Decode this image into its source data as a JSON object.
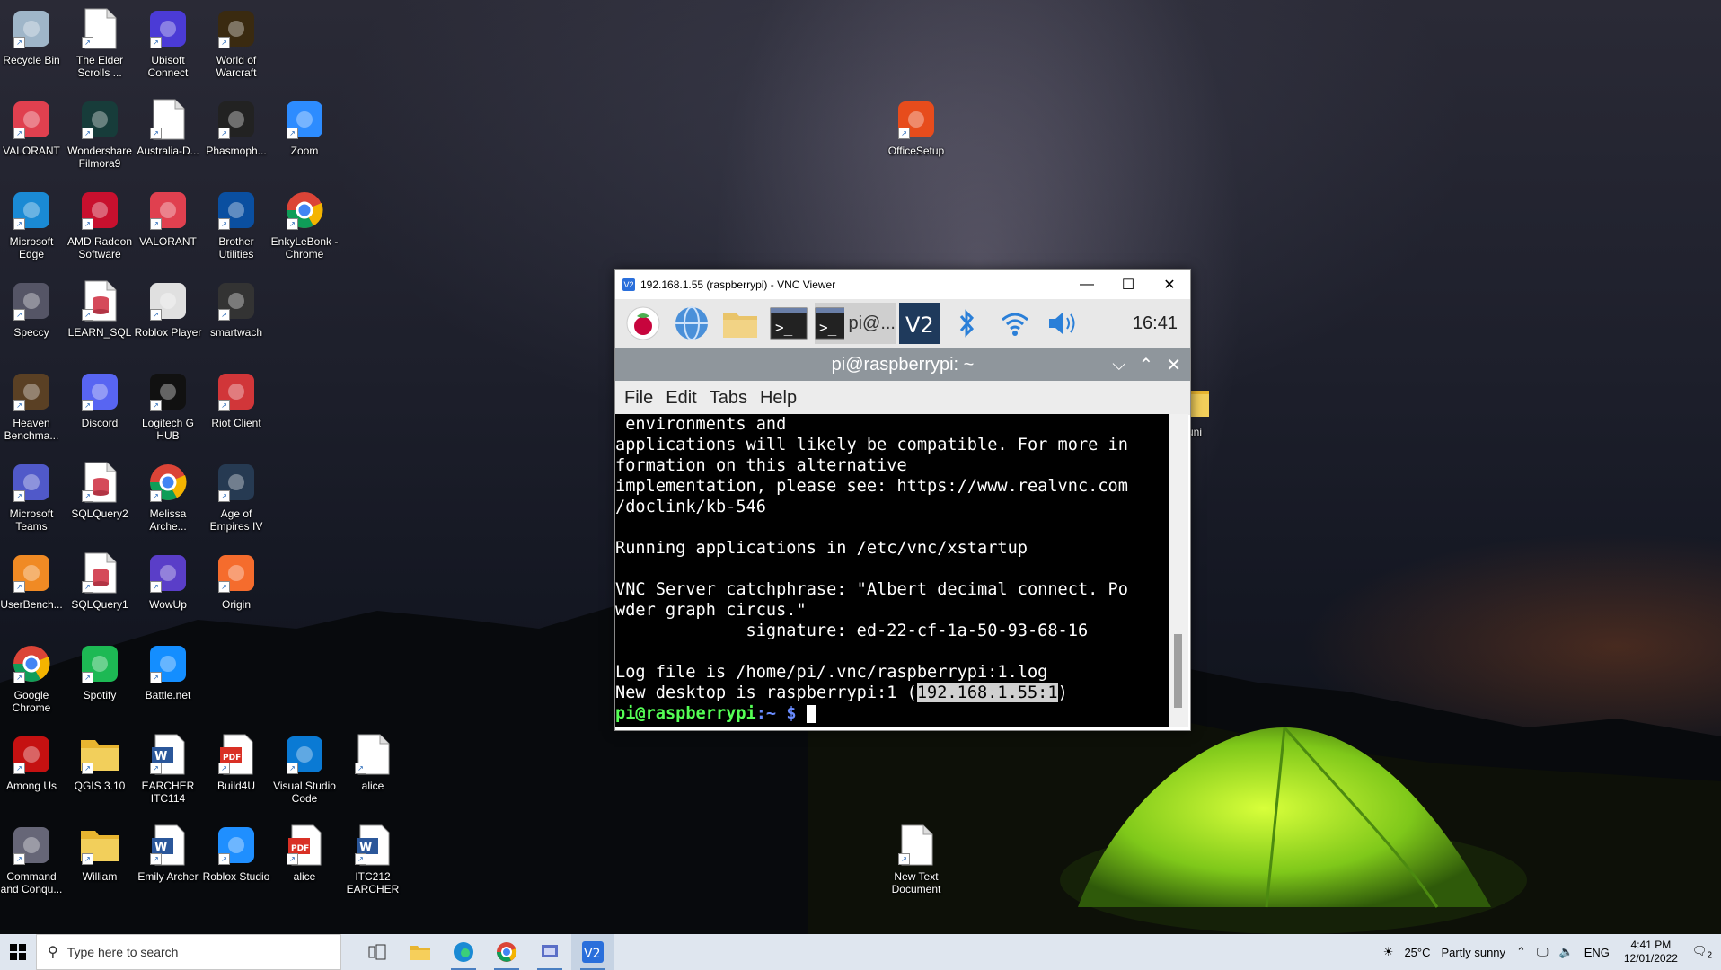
{
  "desktop": {
    "icons": [
      {
        "label": "Recycle Bin",
        "icon": "recycle-bin-icon"
      },
      {
        "label": "The Elder Scrolls ...",
        "icon": "file-icon"
      },
      {
        "label": "Ubisoft Connect",
        "icon": "ubisoft-icon"
      },
      {
        "label": "World of Warcraft",
        "icon": "warcraft-icon"
      },
      {
        "label": "VALORANT",
        "icon": "valorant-icon"
      },
      {
        "label": "Wondershare Filmora9",
        "icon": "filmora-icon"
      },
      {
        "label": "Australia-D...",
        "icon": "file-icon"
      },
      {
        "label": "Phasmoph...",
        "icon": "phasmophobia-icon"
      },
      {
        "label": "Zoom",
        "icon": "zoom-icon"
      },
      {
        "label": "Microsoft Edge",
        "icon": "edge-icon"
      },
      {
        "label": "AMD Radeon Software",
        "icon": "amd-icon"
      },
      {
        "label": "VALORANT",
        "icon": "valorant-icon"
      },
      {
        "label": "Brother Utilities",
        "icon": "brother-icon"
      },
      {
        "label": "EnkyLeBonk - Chrome",
        "icon": "chrome-icon"
      },
      {
        "label": "Speccy",
        "icon": "speccy-icon"
      },
      {
        "label": "LEARN_SQL",
        "icon": "sql-icon"
      },
      {
        "label": "Roblox Player",
        "icon": "roblox-icon"
      },
      {
        "label": "smartwach",
        "icon": "smartwatch-icon"
      },
      {
        "label": "Heaven Benchma...",
        "icon": "heaven-icon"
      },
      {
        "label": "Discord",
        "icon": "discord-icon"
      },
      {
        "label": "Logitech G HUB",
        "icon": "logitech-icon"
      },
      {
        "label": "Riot Client",
        "icon": "riot-icon"
      },
      {
        "label": "Microsoft Teams",
        "icon": "teams-icon"
      },
      {
        "label": "SQLQuery2",
        "icon": "sql-icon"
      },
      {
        "label": "Melissa Arche...",
        "icon": "chrome-icon"
      },
      {
        "label": "Age of Empires IV",
        "icon": "aoe-icon"
      },
      {
        "label": "UserBench...",
        "icon": "userbenchmark-icon"
      },
      {
        "label": "SQLQuery1",
        "icon": "sql-icon"
      },
      {
        "label": "WowUp",
        "icon": "wowup-icon"
      },
      {
        "label": "Origin",
        "icon": "origin-icon"
      },
      {
        "label": "Google Chrome",
        "icon": "chrome-icon"
      },
      {
        "label": "Spotify",
        "icon": "spotify-icon"
      },
      {
        "label": "Battle.net",
        "icon": "battlenet-icon"
      },
      {
        "label": "Among Us",
        "icon": "among-us-icon"
      },
      {
        "label": "QGIS 3.10",
        "icon": "folder-icon"
      },
      {
        "label": "EARCHER ITC114",
        "icon": "word-icon"
      },
      {
        "label": "Build4U",
        "icon": "pdf-icon"
      },
      {
        "label": "Visual Studio Code",
        "icon": "vscode-icon"
      },
      {
        "label": "alice",
        "icon": "file-icon"
      },
      {
        "label": "Command and Conqu...",
        "icon": "cnc-icon"
      },
      {
        "label": "William",
        "icon": "folder-icon"
      },
      {
        "label": "Emily Archer",
        "icon": "word-icon"
      },
      {
        "label": "Roblox Studio",
        "icon": "roblox-studio-icon"
      },
      {
        "label": "alice",
        "icon": "pdf-icon"
      },
      {
        "label": "ITC212 EARCHER",
        "icon": "word-icon"
      },
      {
        "label": "OfficeSetup",
        "icon": "office-icon"
      },
      {
        "label": "New Text Document",
        "icon": "file-icon"
      },
      {
        "label": "1 uni",
        "icon": "folder-icon"
      }
    ]
  },
  "vnc_window": {
    "title": "192.168.1.55 (raspberrypi) - VNC Viewer",
    "minimize": "—",
    "maximize": "☐",
    "close": "✕",
    "panel": {
      "clock": "16:41",
      "task_label": "pi@..."
    },
    "terminal": {
      "title": "pi@raspberrypi: ~",
      "menu": [
        "File",
        "Edit",
        "Tabs",
        "Help"
      ],
      "lines": [
        " environments and",
        "applications will likely be compatible. For more in",
        "formation on this alternative",
        "implementation, please see: https://www.realvnc.com",
        "/doclink/kb-546",
        "",
        "Running applications in /etc/vnc/xstartup",
        "",
        "VNC Server catchphrase: \"Albert decimal connect. Po",
        "wder graph circus.\"",
        "             signature: ed-22-cf-1a-50-93-68-16",
        "",
        "Log file is /home/pi/.vnc/raspberrypi:1.log"
      ],
      "desktop_line_prefix": "New desktop is raspberrypi:1 (",
      "desktop_line_highlight": "192.168.1.55:1",
      "desktop_line_suffix": ")",
      "prompt_user": "pi@raspberrypi",
      "prompt_path": ":~ $"
    }
  },
  "taskbar": {
    "search_placeholder": "Type here to search",
    "weather_temp": "25°C",
    "weather_desc": "Partly sunny",
    "language": "ENG",
    "time": "4:41 PM",
    "date": "12/01/2022",
    "notifications": "2"
  }
}
